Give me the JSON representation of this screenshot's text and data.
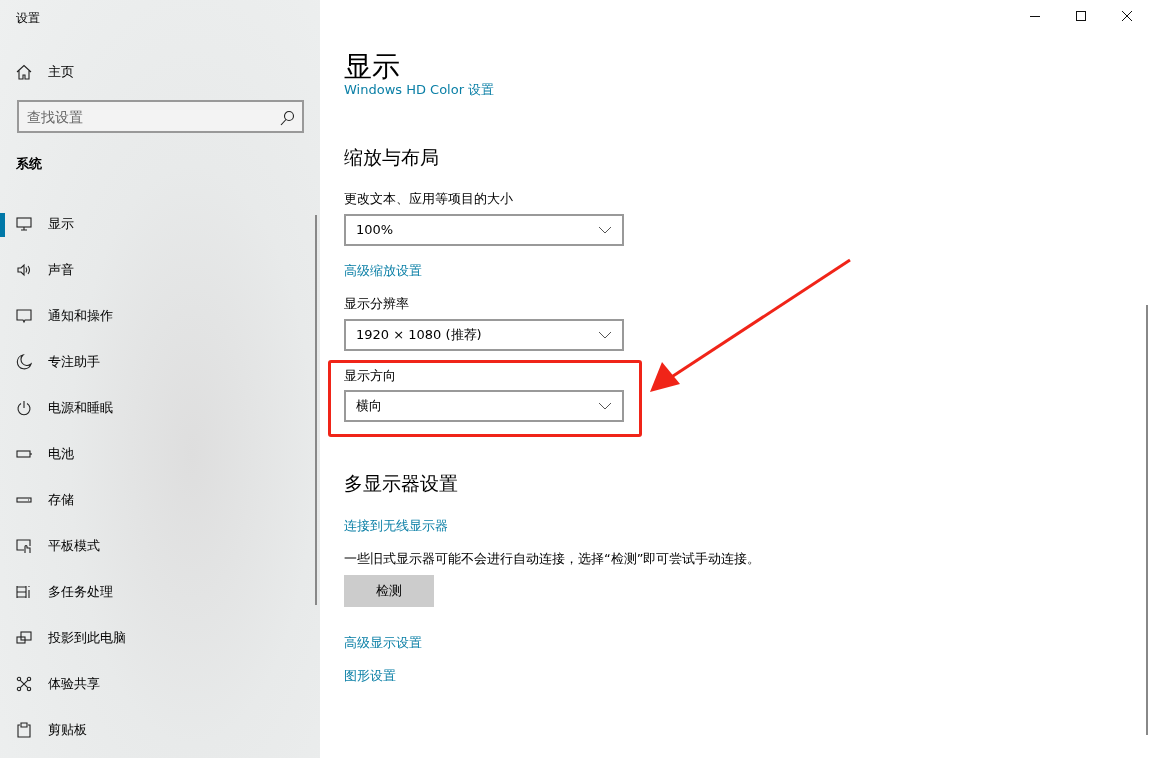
{
  "window": {
    "title": "设置"
  },
  "sidebar": {
    "home": "主页",
    "search": {
      "placeholder": "查找设置"
    },
    "section": "系统",
    "items": [
      {
        "label": "显示",
        "selected": true
      },
      {
        "label": "声音",
        "selected": false
      },
      {
        "label": "通知和操作",
        "selected": false
      },
      {
        "label": "专注助手",
        "selected": false
      },
      {
        "label": "电源和睡眠",
        "selected": false
      },
      {
        "label": "电池",
        "selected": false
      },
      {
        "label": "存储",
        "selected": false
      },
      {
        "label": "平板模式",
        "selected": false
      },
      {
        "label": "多任务处理",
        "selected": false
      },
      {
        "label": "投影到此电脑",
        "selected": false
      },
      {
        "label": "体验共享",
        "selected": false
      },
      {
        "label": "剪贴板",
        "selected": false
      }
    ]
  },
  "page": {
    "title": "显示",
    "blocks": [
      {
        "kind": "link",
        "text": "Windows HD Color 设置"
      },
      {
        "kind": "heading",
        "text": "缩放与布局"
      },
      {
        "kind": "dropdown",
        "label": "更改文本、应用等项目的大小",
        "value": "100%",
        "highlighted": false
      },
      {
        "kind": "link",
        "text": "高级缩放设置"
      },
      {
        "kind": "dropdown",
        "label": "显示分辨率",
        "value": "1920 × 1080 (推荐)",
        "highlighted": false
      },
      {
        "kind": "dropdown",
        "label": "显示方向",
        "value": "横向",
        "highlighted": true
      },
      {
        "kind": "heading",
        "text": "多显示器设置"
      },
      {
        "kind": "link",
        "text": "连接到无线显示器"
      },
      {
        "kind": "text",
        "text": "一些旧式显示器可能不会进行自动连接，选择“检测”即可尝试手动连接。"
      },
      {
        "kind": "button",
        "text": "检测"
      },
      {
        "kind": "link",
        "text": "高级显示设置"
      },
      {
        "kind": "link",
        "text": "图形设置"
      }
    ]
  }
}
